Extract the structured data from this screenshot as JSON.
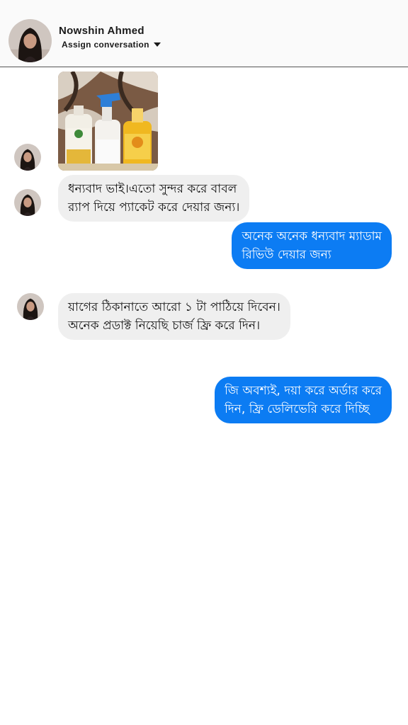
{
  "header": {
    "contact_name": "Nowshin Ahmed",
    "assign_label": "Assign conversation",
    "assign_icon": "caret-down-icon"
  },
  "colors": {
    "outgoing_bubble": "#0c7cf3",
    "incoming_bubble": "#efefef",
    "header_bg": "#fafafa"
  },
  "messages": [
    {
      "type": "photo",
      "direction": "incoming",
      "description_icon": "product-photo"
    },
    {
      "type": "text",
      "direction": "incoming",
      "lines": [
        "ধন্যবাদ ভাই।এতো সুন্দর করে বাবল",
        "র‍্যাপ দিয়ে প্যাকেট করে দেয়ার জন্য।"
      ]
    },
    {
      "type": "text",
      "direction": "outgoing",
      "lines": [
        "অনেক অনেক ধন্যবাদ ম্যাডাম",
        "রিভিউ দেয়ার জন্য"
      ]
    },
    {
      "type": "text",
      "direction": "incoming",
      "lines": [
        "য়াগের ঠিকানাতে আরো ১ টা পাঠিয়ে দিবেন।",
        "অনেক প্রডাক্ট নিয়েছি চার্জ ফ্রি করে দিন।"
      ]
    },
    {
      "type": "text",
      "direction": "outgoing",
      "lines": [
        "জি অবশ্যই, দয়া করে অর্ডার করে",
        "দিন, ফ্রি ডেলিভেরি করে দিচ্ছি"
      ]
    }
  ]
}
